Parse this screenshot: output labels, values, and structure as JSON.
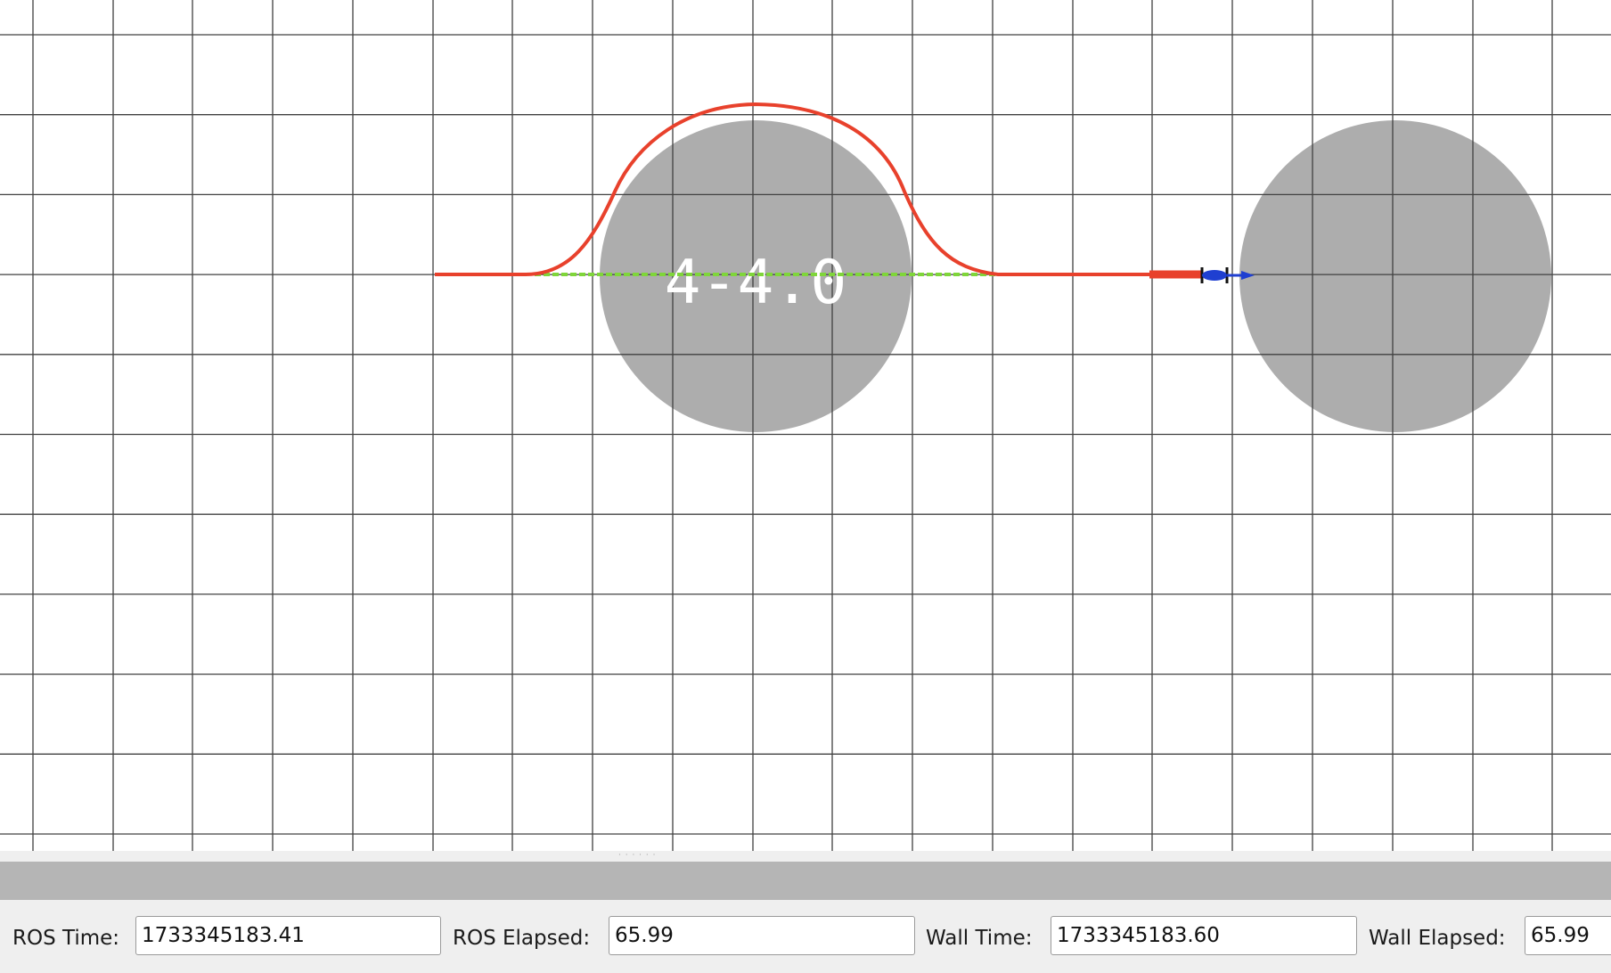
{
  "viewport": {
    "grid_color": "#404040",
    "obstacle_color": "#adadad",
    "path_color": "#e8412c",
    "plan_color": "#7fd63a",
    "robot_color": "#1f3fd1",
    "cell_label": "4-4.0",
    "cell_label_color": "#ffffff"
  },
  "time_panel": {
    "ros_time_label": "ROS Time:",
    "ros_time_value": "1733345183.41",
    "ros_elapsed_label": "ROS Elapsed:",
    "ros_elapsed_value": "65.99",
    "wall_time_label": "Wall Time:",
    "wall_time_value": "1733345183.60",
    "wall_elapsed_label": "Wall Elapsed:",
    "wall_elapsed_value": "65.99"
  }
}
